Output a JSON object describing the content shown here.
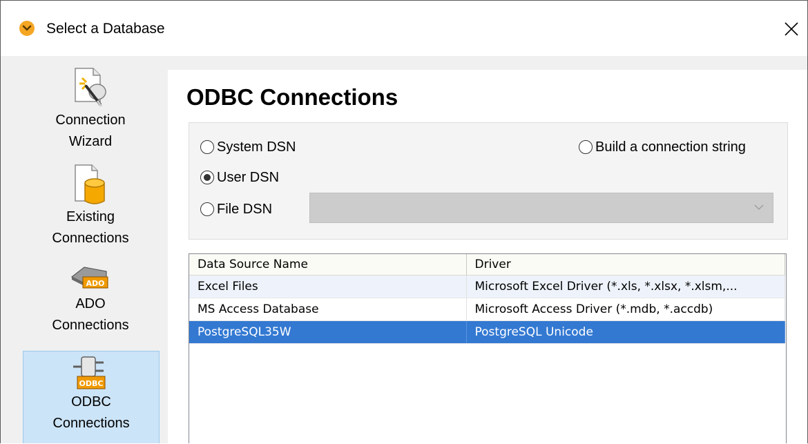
{
  "window": {
    "title": "Select a Database"
  },
  "sidebar": {
    "items": [
      {
        "label_line1": "Connection",
        "label_line2": "Wizard",
        "icon": "connection-wizard-icon",
        "selected": false
      },
      {
        "label_line1": "Existing",
        "label_line2": "Connections",
        "icon": "existing-connections-icon",
        "selected": false
      },
      {
        "label_line1": "ADO",
        "label_line2": "Connections",
        "icon": "ado-icon",
        "icon_text": "ADO",
        "selected": false
      },
      {
        "label_line1": "ODBC",
        "label_line2": "Connections",
        "icon": "odbc-icon",
        "icon_text": "ODBC",
        "selected": true
      }
    ]
  },
  "main": {
    "title": "ODBC Connections",
    "radios": {
      "system_dsn": {
        "label": "System DSN",
        "checked": false
      },
      "build_string": {
        "label": "Build a connection string",
        "checked": false
      },
      "user_dsn": {
        "label": "User DSN",
        "checked": true
      },
      "file_dsn": {
        "label": "File DSN",
        "checked": false
      }
    },
    "file_dsn_select": {
      "value": "",
      "enabled": false
    },
    "table": {
      "columns": [
        "Data Source Name",
        "Driver"
      ],
      "rows": [
        {
          "name": "Excel Files",
          "driver": "Microsoft Excel Driver (*.xls, *.xlsx, *.xlsm,...",
          "selected": false
        },
        {
          "name": "MS Access Database",
          "driver": "Microsoft Access Driver (*.mdb, *.accdb)",
          "selected": false
        },
        {
          "name": "PostgreSQL35W",
          "driver": "PostgreSQL Unicode",
          "selected": true
        }
      ]
    }
  },
  "colors": {
    "selection": "#3379d2",
    "sidebar_selected": "#cce4f7",
    "app_icon": "#f5a623"
  }
}
